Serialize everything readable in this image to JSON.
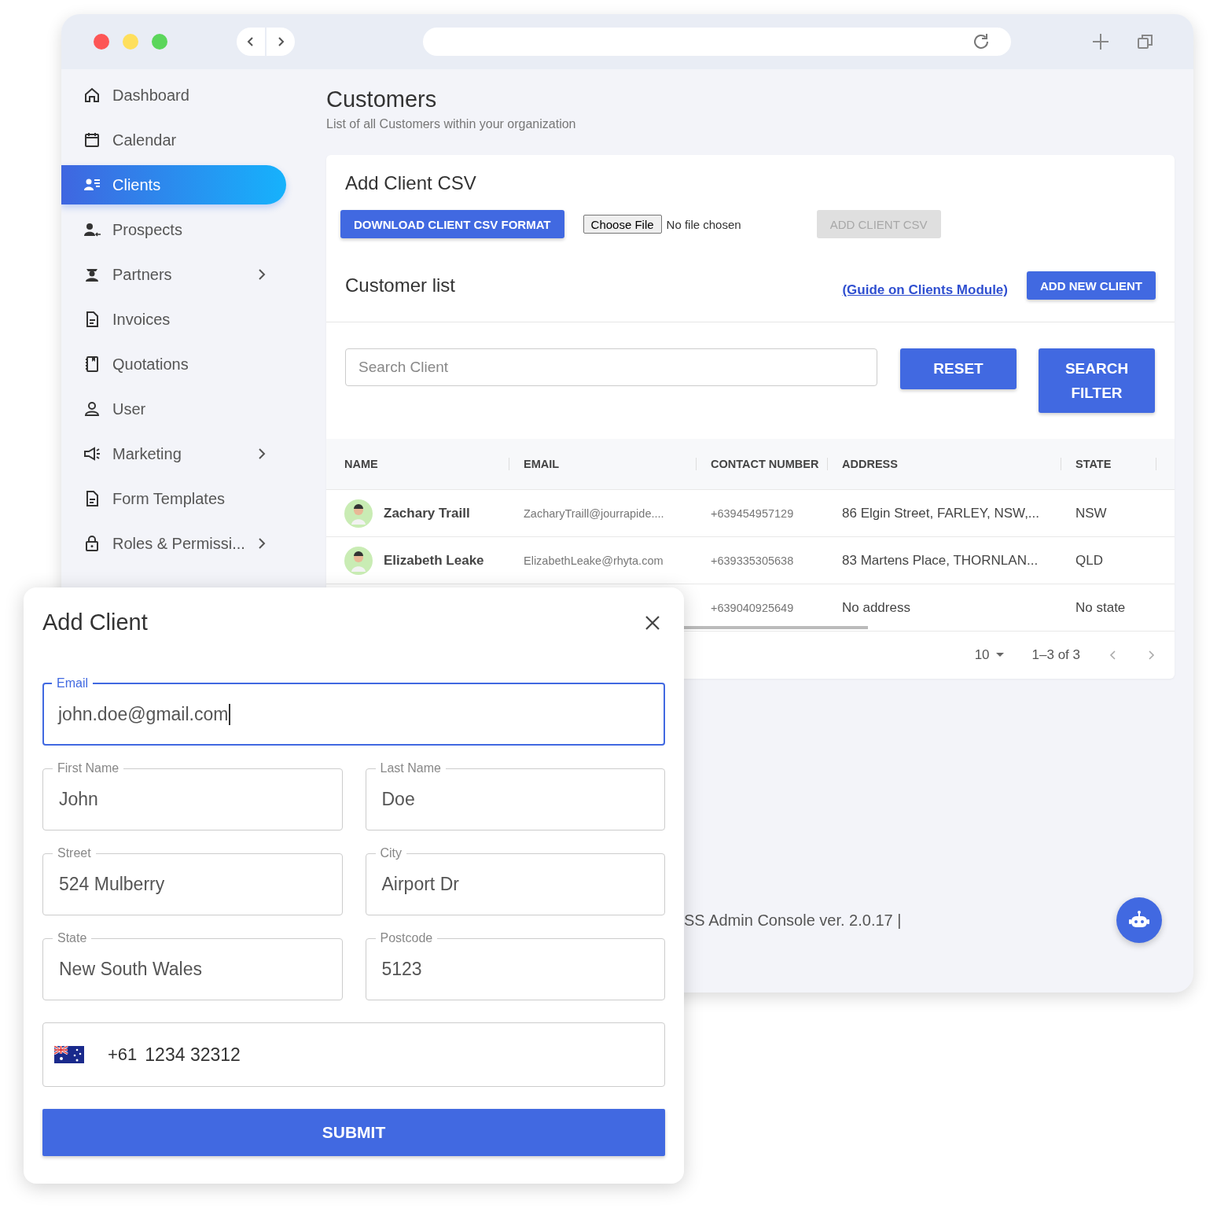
{
  "sidebar": {
    "items": [
      {
        "label": "Dashboard",
        "selected": false,
        "has_submenu": false
      },
      {
        "label": "Calendar",
        "selected": false,
        "has_submenu": false
      },
      {
        "label": "Clients",
        "selected": true,
        "has_submenu": false
      },
      {
        "label": "Prospects",
        "selected": false,
        "has_submenu": false
      },
      {
        "label": "Partners",
        "selected": false,
        "has_submenu": true
      },
      {
        "label": "Invoices",
        "selected": false,
        "has_submenu": false
      },
      {
        "label": "Quotations",
        "selected": false,
        "has_submenu": false
      },
      {
        "label": "User",
        "selected": false,
        "has_submenu": false
      },
      {
        "label": "Marketing",
        "selected": false,
        "has_submenu": true
      },
      {
        "label": "Form Templates",
        "selected": false,
        "has_submenu": false
      },
      {
        "label": "Roles & Permissi...",
        "selected": false,
        "has_submenu": true
      }
    ]
  },
  "header": {
    "title": "Customers",
    "subtitle": "List of all Customers within your organization"
  },
  "csv": {
    "title": "Add Client CSV",
    "download_button": "DOWNLOAD CLIENT CSV FORMAT",
    "file_button": "Choose File",
    "file_status": "No file chosen",
    "add_button": {
      "label": "ADD CLIENT CSV",
      "disabled": true
    }
  },
  "customer_list": {
    "title": "Customer list",
    "guide_link": "(Guide on Clients Module)",
    "add_button": "ADD NEW CLIENT",
    "search": {
      "placeholder": "Search Client"
    },
    "reset_button": "RESET",
    "filter_button": "SEARCH FILTER",
    "table": {
      "columns": [
        "NAME",
        "EMAIL",
        "CONTACT NUMBER",
        "ADDRESS",
        "STATE"
      ],
      "rows": [
        {
          "name": "Zachary Traill",
          "email": "ZacharyTraill@jourrapide....",
          "contact": "+639454957129",
          "address": "86 Elgin Street, FARLEY, NSW,...",
          "state": "NSW"
        },
        {
          "name": "Elizabeth Leake",
          "email": "ElizabethLeake@rhyta.com",
          "contact": "+639335305638",
          "address": "83 Martens Place, THORNLAN...",
          "state": "QLD"
        },
        {
          "contact": "+639040925649",
          "address": "No address",
          "state": "No state"
        }
      ]
    },
    "pagination": {
      "per_page": "10",
      "range": "1–3 of 3"
    }
  },
  "footer": {
    "text": "SS Admin Console ver. 2.0.17 |"
  },
  "modal": {
    "title": "Add Client",
    "fields": [
      {
        "label": "Email",
        "value": "john.doe@gmail.com",
        "focused": true
      },
      {
        "label": "First Name",
        "value": "John",
        "focused": false
      },
      {
        "label": "Last Name",
        "value": "Doe",
        "focused": false
      },
      {
        "label": "Street",
        "value": "524 Mulberry",
        "focused": false
      },
      {
        "label": "City",
        "value": "Airport Dr",
        "focused": false
      },
      {
        "label": "State",
        "value": "New South Wales",
        "focused": false
      },
      {
        "label": "Postcode",
        "value": "5123",
        "focused": false
      }
    ],
    "phone": {
      "code": "+61",
      "number": "1234 32312"
    },
    "submit": "SUBMIT"
  }
}
